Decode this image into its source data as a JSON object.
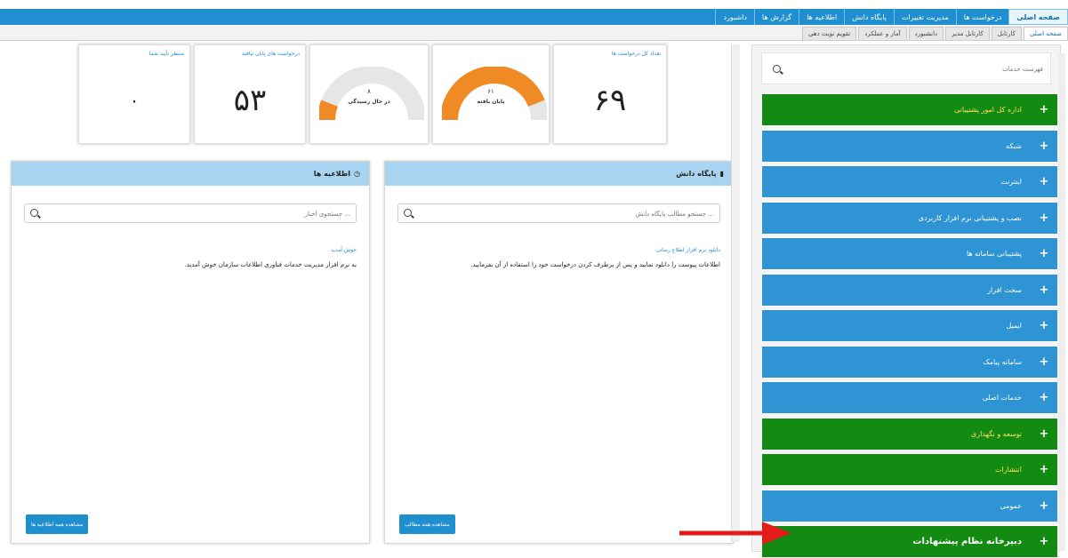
{
  "topnav": {
    "items": [
      "صفحه اصلی",
      "درخواست ها",
      "مدیریت تغییرات",
      "پایگاه دانش",
      "اطلاعیه ها",
      "گزارش ها",
      "داشبورد",
      ""
    ]
  },
  "subnav": {
    "items": [
      "صفحه اصلی",
      "کارتابل",
      "کارتابل مدیر",
      "دانشبورد",
      "آمار و عملکرد",
      "تقویم نوبت دهی"
    ]
  },
  "stats": {
    "total_requests_label": "تعداد کل درخواست ها",
    "total_requests_value": "۶۹",
    "resolved_value": "۶۱",
    "resolved_label": "پایان یافته",
    "pending_value": "۸",
    "pending_label": "در حال رسیدگی",
    "unresolved_label": "درخواست های پایان نیافته",
    "unresolved_value": "۵۳",
    "overdue_label": "منتظر تأیید شما",
    "overdue_value": "٠",
    "resolved_fraction": 0.88,
    "pending_fraction": 0.12
  },
  "knowledge_panel": {
    "title": "پایگاه دانش",
    "search_placeholder": "جستجو مطالب پایگاه دانش ...",
    "link": "دانلود نرم افزار اطلاع رسانی",
    "text": "اطلاعات پیوست را دانلود نمایید و پس از برطرف کردن درخواست خود را استفاده از آن بفرمایید.",
    "button": "مشاهده همه مطالب"
  },
  "news_panel": {
    "title": "اطلاعیه ها",
    "search_placeholder": "جستجوی اخبار ...",
    "link": "خوش آمدید",
    "text": "به نرم افزار مدیریت خدمات فناوری اطلاعات سازمان خوش آمدید.",
    "button": "مشاهده همه اطلاعیه ها"
  },
  "sidebar": {
    "search_placeholder": "فهرست خدمات",
    "items": [
      {
        "label": "اداره کل امور پشتیبانی",
        "color": "green"
      },
      {
        "label": "شبکه",
        "color": "blue"
      },
      {
        "label": "اینترنت",
        "color": "blue"
      },
      {
        "label": "نصب و پشتیبانی نرم افزار کاربردی",
        "color": "blue"
      },
      {
        "label": "پشتیبانی سامانه ها",
        "color": "blue"
      },
      {
        "label": "سخت افزار",
        "color": "blue"
      },
      {
        "label": "ایمیل",
        "color": "blue"
      },
      {
        "label": "سامانه پیامک",
        "color": "blue"
      },
      {
        "label": "خدمات اصلی",
        "color": "blue"
      },
      {
        "label": "توسعه و نگهداری",
        "color": "green"
      },
      {
        "label": "انتشارات",
        "color": "green"
      },
      {
        "label": "عمومی",
        "color": "blue"
      },
      {
        "label": "دبیرخانه نظام پیشنهادات",
        "color": "green"
      }
    ]
  },
  "colors": {
    "primary_blue": "#1f8fd0",
    "green": "#138a12",
    "gauge_orange": "#f08a24",
    "arrow_red": "#e21b1b"
  }
}
